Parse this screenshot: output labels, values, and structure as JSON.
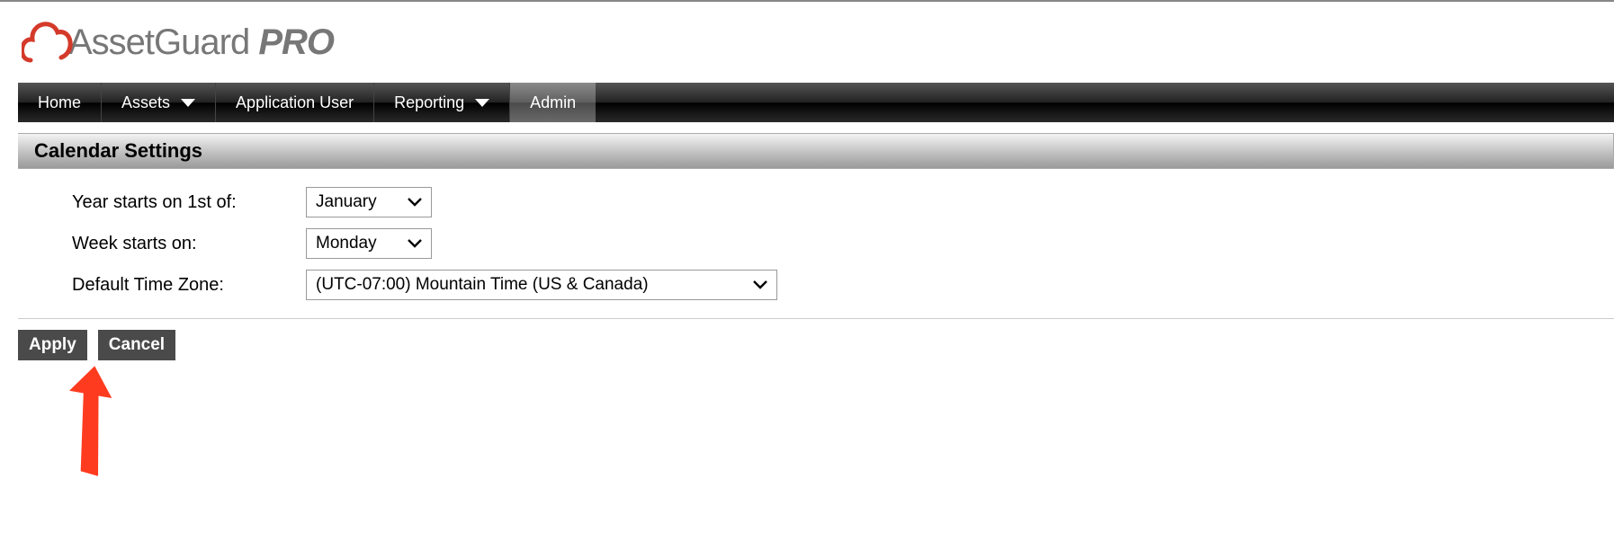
{
  "brand": {
    "name_a": "AssetGuard ",
    "name_b": "PRO"
  },
  "nav": {
    "items": [
      {
        "label": "Home",
        "dropdown": false,
        "active": false
      },
      {
        "label": "Assets",
        "dropdown": true,
        "active": false
      },
      {
        "label": "Application User",
        "dropdown": false,
        "active": false
      },
      {
        "label": "Reporting",
        "dropdown": true,
        "active": false
      },
      {
        "label": "Admin",
        "dropdown": false,
        "active": true
      }
    ]
  },
  "panel": {
    "title": "Calendar Settings",
    "fields": {
      "year_start": {
        "label": "Year starts on 1st of:",
        "value": "January"
      },
      "week_start": {
        "label": "Week starts on:",
        "value": "Monday"
      },
      "time_zone": {
        "label": "Default Time Zone:",
        "value": "(UTC-07:00) Mountain Time (US & Canada)"
      }
    }
  },
  "buttons": {
    "apply": "Apply",
    "cancel": "Cancel"
  }
}
